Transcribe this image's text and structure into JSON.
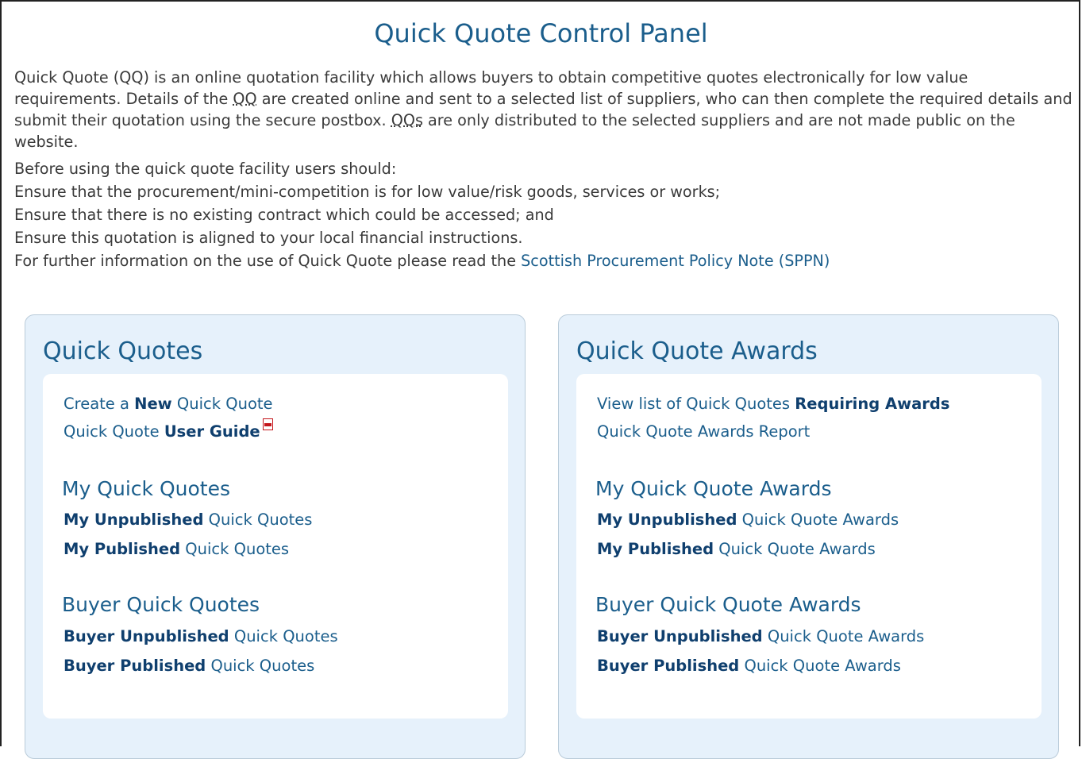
{
  "page": {
    "title": "Quick Quote Control Panel"
  },
  "intro": {
    "para1_before_qq1": "Quick Quote (QQ) is an online quotation facility which allows buyers to obtain competitive quotes electronically for low value requirements. Details of the ",
    "abbr_qq": "QQ",
    "para1_mid": " are created online and sent to a selected list of suppliers, who can then complete the required details and submit their quotation using the secure postbox. ",
    "abbr_qqs": "QQs",
    "para1_after": " are only distributed to the selected suppliers and are not made public on the website.",
    "line2": "Before using the quick quote facility users should:",
    "line3": "Ensure that the procurement/mini-competition is for low value/risk goods, services or works;",
    "line4": "Ensure that there is no existing contract which could be accessed; and",
    "line5": "Ensure this quotation is aligned to your local financial instructions.",
    "line6_prefix": "For further information on the use of Quick Quote please read the ",
    "sppn_link": "Scottish Procurement Policy Note (SPPN)"
  },
  "quick_quotes": {
    "heading": "Quick Quotes",
    "create_pre": "Create a ",
    "create_bold": "New",
    "create_post": " Quick Quote",
    "guide_pre": "Quick Quote ",
    "guide_bold": "User Guide",
    "my_heading": "My Quick Quotes",
    "my_unpub_bold": "My Unpublished",
    "my_unpub_rest": " Quick Quotes",
    "my_pub_bold": "My Published",
    "my_pub_rest": " Quick Quotes",
    "buyer_heading": "Buyer Quick Quotes",
    "buyer_unpub_bold": "Buyer Unpublished",
    "buyer_unpub_rest": " Quick Quotes",
    "buyer_pub_bold": "Buyer Published",
    "buyer_pub_rest": " Quick Quotes"
  },
  "awards": {
    "heading": "Quick Quote Awards",
    "req_pre": "View list of Quick Quotes ",
    "req_bold": "Requiring Awards",
    "report": "Quick Quote Awards Report",
    "my_heading": "My Quick Quote Awards",
    "my_unpub_bold": "My Unpublished",
    "my_unpub_rest": " Quick Quote Awards",
    "my_pub_bold": "My Published",
    "my_pub_rest": " Quick Quote Awards",
    "buyer_heading": "Buyer Quick Quote Awards",
    "buyer_unpub_bold": "Buyer Unpublished",
    "buyer_unpub_rest": " Quick Quote Awards",
    "buyer_pub_bold": "Buyer Published",
    "buyer_pub_rest": " Quick Quote Awards"
  },
  "icons": {
    "pdf": "pdf-icon"
  },
  "colors": {
    "link": "#1b5e8c",
    "panel_bg": "#e6f1fb"
  }
}
